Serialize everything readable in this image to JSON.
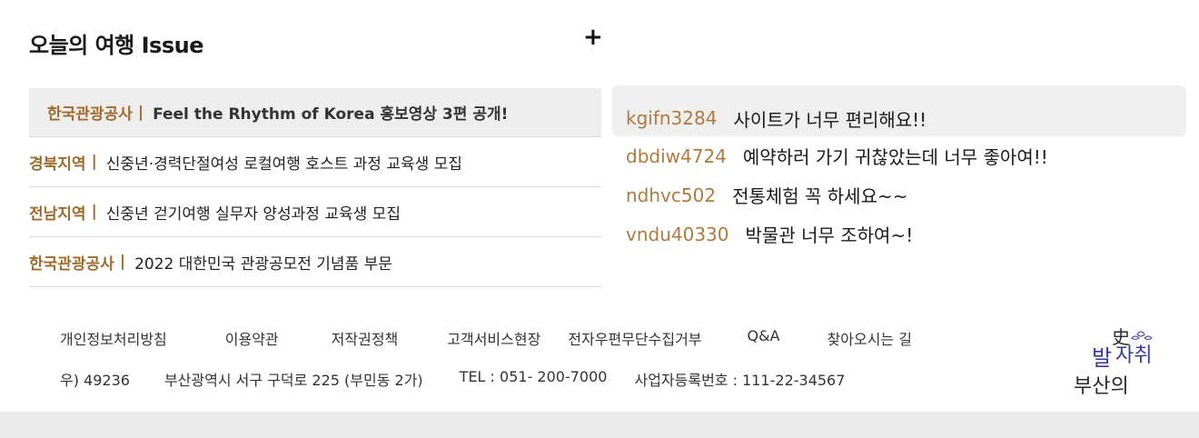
{
  "issue": {
    "title": "오늘의 여행 Issue",
    "more_label": "+",
    "items": [
      {
        "org": "한국관광공사",
        "sep": "|",
        "text": "Feel the Rhythm of Korea 홍보영상 3편 공개!"
      },
      {
        "org": "경북지역",
        "sep": "|",
        "text": "신중년·경력단절여성 로컬여행 호스트 과정 교육생 모집"
      },
      {
        "org": "전남지역",
        "sep": "|",
        "text": "신중년 걷기여행 실무자 양성과정 교육생 모집"
      },
      {
        "org": "한국관광공사",
        "sep": "|",
        "text": "2022 대한민국 관광공모전 기념품 부문"
      }
    ]
  },
  "reviews": [
    {
      "user": "kgifn3284",
      "text": "사이트가 너무 편리해요!!"
    },
    {
      "user": "dbdiw4724",
      "text": "예약하러 가기 귀찮았는데 너무 좋아여!!"
    },
    {
      "user": "ndhvc502",
      "text": "전통체험 꼭 하세요~~"
    },
    {
      "user": "vndu40330",
      "text": "박물관 너무 조하여~!"
    }
  ],
  "footer": {
    "links": [
      "개인정보처리방침",
      "이용약관",
      "저작권정책",
      "고객서비스현장",
      "전자우편무단수집거부",
      "Q&A",
      "찾아오시는 길"
    ],
    "address": "우) 49236",
    "location": "부산광역시 서구 구덕로 225 (부민동 2가)",
    "tel": "TEL : 051- 200-7000",
    "business_no": "사업자등록번호 : 111-22-34567"
  },
  "logo": {
    "line1_a": "발",
    "line1_b": "자취",
    "top_char": "史",
    "line2": "부산의",
    "color": "#3a3a9a"
  }
}
